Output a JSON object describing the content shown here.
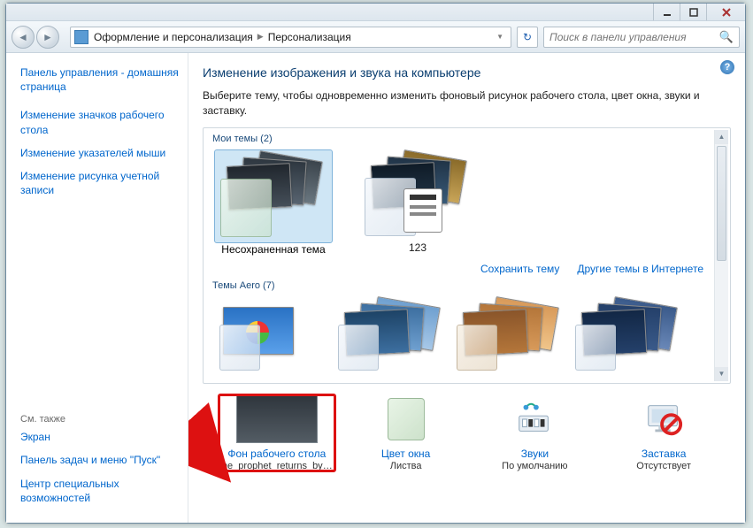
{
  "breadcrumb": {
    "crumb1": "Оформление и персонализация",
    "crumb2": "Персонализация"
  },
  "search": {
    "placeholder": "Поиск в панели управления"
  },
  "sidebar": {
    "home": "Панель управления - домашняя страница",
    "links": [
      "Изменение значков рабочего стола",
      "Изменение указателей мыши",
      "Изменение рисунка учетной записи"
    ],
    "see_also_label": "См. также",
    "see_also": [
      "Экран",
      "Панель задач и меню \"Пуск\"",
      "Центр специальных возможностей"
    ]
  },
  "main": {
    "title": "Изменение изображения и звука на компьютере",
    "desc": "Выберите тему, чтобы одновременно изменить фоновый рисунок рабочего стола, цвет окна, звуки и заставку.",
    "my_themes_label": "Мои темы (2)",
    "my_themes": [
      {
        "name": "Несохраненная тема"
      },
      {
        "name": "123"
      }
    ],
    "save_theme": "Сохранить тему",
    "more_themes": "Другие темы в Интернете",
    "aero_label": "Темы Aero (7)"
  },
  "options": {
    "bg": {
      "label": "Фон рабочего стола",
      "value": "the_prophet_returns_by_m..."
    },
    "color": {
      "label": "Цвет окна",
      "value": "Листва"
    },
    "sound": {
      "label": "Звуки",
      "value": "По умолчанию"
    },
    "saver": {
      "label": "Заставка",
      "value": "Отсутствует"
    }
  }
}
